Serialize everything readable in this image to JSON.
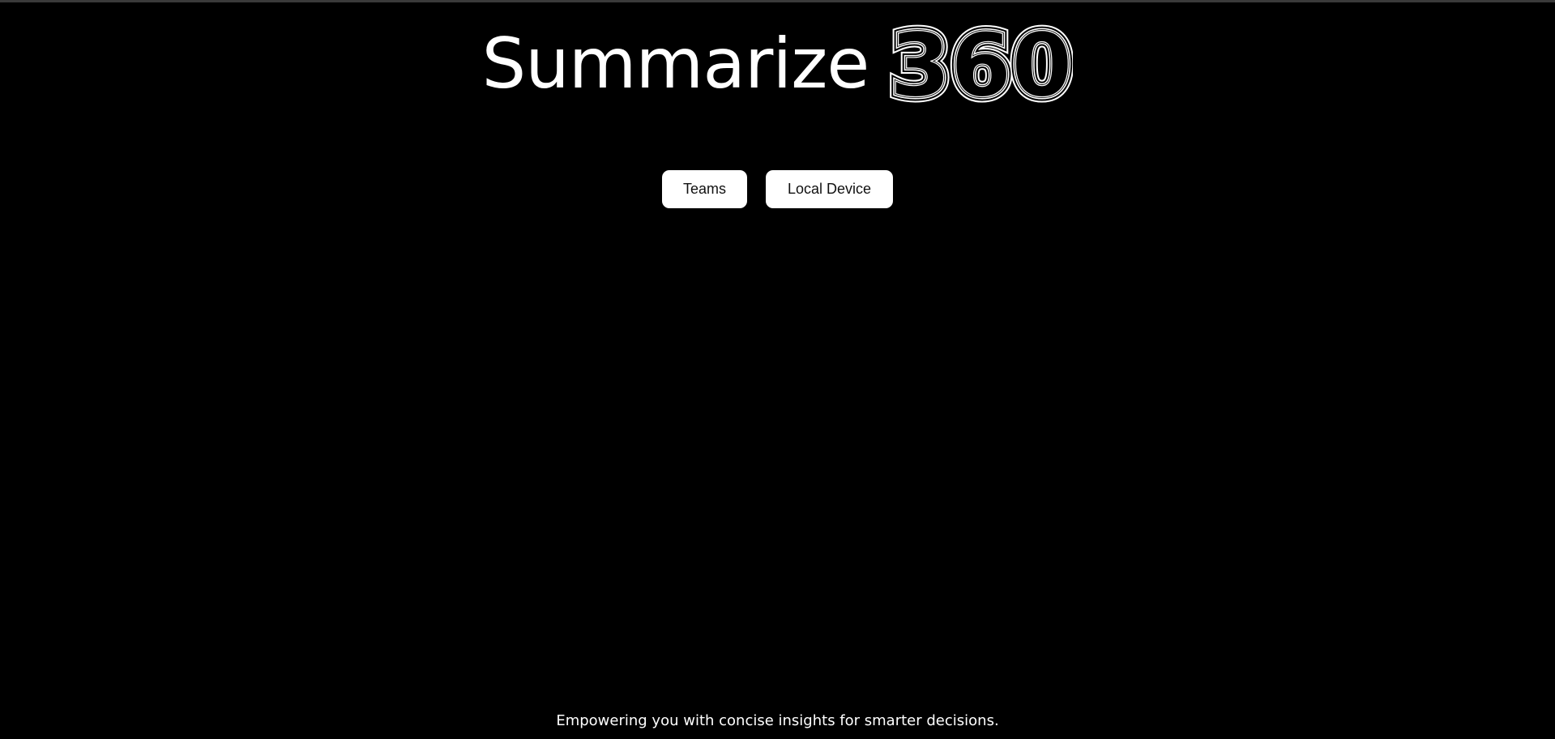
{
  "header": {
    "title_text": "Summarize",
    "title_number": "360"
  },
  "actions": {
    "teams_label": "Teams",
    "local_device_label": "Local Device"
  },
  "footer": {
    "tagline": "Empowering you with concise insights for smarter decisions."
  },
  "colors": {
    "background": "#000000",
    "text": "#ffffff",
    "button_bg": "#ffffff",
    "button_text": "#111111"
  }
}
